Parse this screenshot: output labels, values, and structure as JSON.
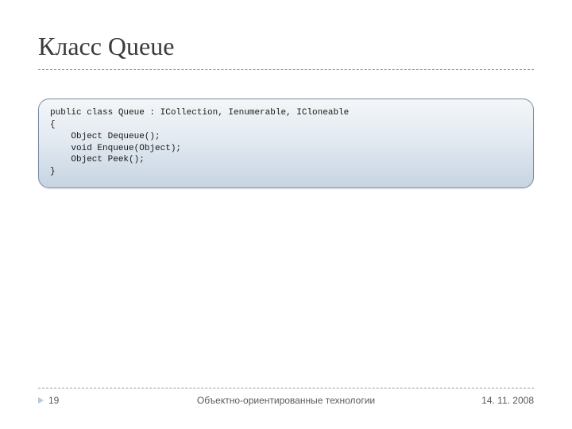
{
  "title": "Класс Queue",
  "code": {
    "l1": "public class Queue : ICollection, Ienumerable, ICloneable",
    "l2": "{",
    "l3": "    Object Dequeue();",
    "l4": "    void Enqueue(Object);",
    "l5": "    Object Peek();",
    "l6": "}"
  },
  "footer": {
    "page": "19",
    "center": "Объектно-ориентированные технологии",
    "date": "14. 11. 2008"
  }
}
